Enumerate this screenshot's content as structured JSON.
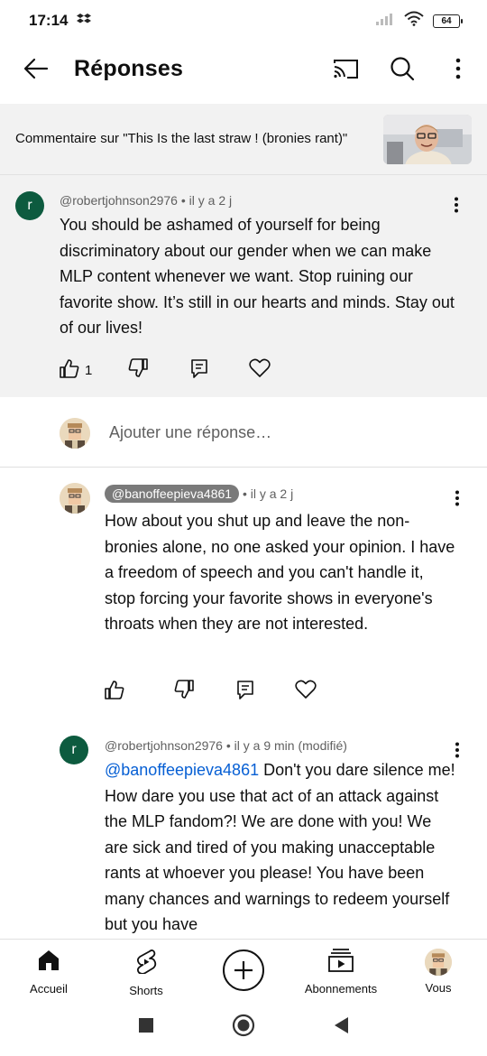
{
  "status": {
    "time": "17:14",
    "battery": "64"
  },
  "header": {
    "title": "Réponses",
    "icons": [
      "back-arrow-icon",
      "cast-icon",
      "search-icon",
      "more-vert-icon"
    ]
  },
  "context": {
    "text": "Commentaire sur \"This Is the last straw ! (bronies rant)\""
  },
  "parent_comment": {
    "avatar_letter": "r",
    "handle": "@robertjohnson2976",
    "time": " • il y a 2 j",
    "body": "You should be ashamed of yourself for being discriminatory about our gender when we can make MLP content whenever we want. Stop ruining our favorite show. It’s still in our hearts and minds. Stay out of our lives!",
    "like_count": "1"
  },
  "add_reply": {
    "placeholder": "Ajouter une réponse…"
  },
  "replies": [
    {
      "handle": "@banoffeepieva4861",
      "time": " • il y a 2 j",
      "body": "How about you shut up and leave the non-bronies alone, no one asked your opinion. I have a freedom of speech and you can't handle it, stop forcing your favorite shows in everyone's throats when they are not interested."
    },
    {
      "avatar_letter": "r",
      "handle": "@robertjohnson2976",
      "time": " • il y a 9 min (modifié)",
      "mention": "@banoffeepieva4861",
      "body": " Don't you dare silence me! How dare you use that act of an attack against the MLP fandom?! We are done with you! We are sick and tired of you making unacceptable rants at whoever you please! You have been many chances and warnings to redeem yourself but you have"
    }
  ],
  "bottom_nav": {
    "home": "Accueil",
    "shorts": "Shorts",
    "subscriptions": "Abonnements",
    "you": "Vous"
  },
  "colors": {
    "avatar_green": "#0d5b3f",
    "mention_blue": "#065fd4",
    "banner_bg": "#f2f2f2"
  }
}
